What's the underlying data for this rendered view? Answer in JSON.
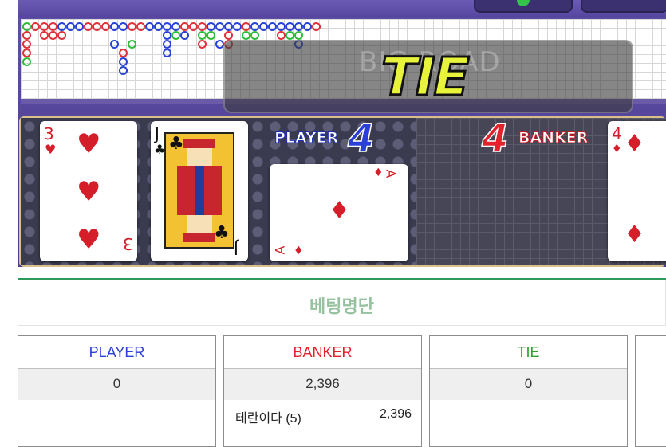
{
  "overlay": {
    "ghost_text": "BIG ROAD",
    "result_text": "TIE"
  },
  "board": {
    "player_label": "PLAYER",
    "player_score": "4",
    "banker_label": "BANKER",
    "banker_score": "4",
    "cards": {
      "player_1": {
        "rank": "3",
        "suit": "♥",
        "name": "three-of-hearts"
      },
      "player_2": {
        "rank": "J",
        "suit": "♣",
        "name": "jack-of-clubs"
      },
      "player_3": {
        "rank": "A",
        "suit": "♦",
        "name": "ace-of-diamonds"
      },
      "banker_1": {
        "rank": "4",
        "suit": "♦",
        "name": "four-of-diamonds"
      }
    }
  },
  "colors": {
    "player": "#2a3ed8",
    "banker": "#e3222c",
    "tie": "#2fa02f",
    "title_green": "#96c2a0"
  },
  "betting": {
    "title": "베팅명단",
    "columns": [
      {
        "header": "PLAYER",
        "total": "0",
        "entries": []
      },
      {
        "header": "BANKER",
        "total": "2,396",
        "entries": [
          {
            "name": "테란이다 (5)",
            "amount": "2,396"
          }
        ]
      },
      {
        "header": "TIE",
        "total": "0",
        "entries": []
      }
    ]
  }
}
